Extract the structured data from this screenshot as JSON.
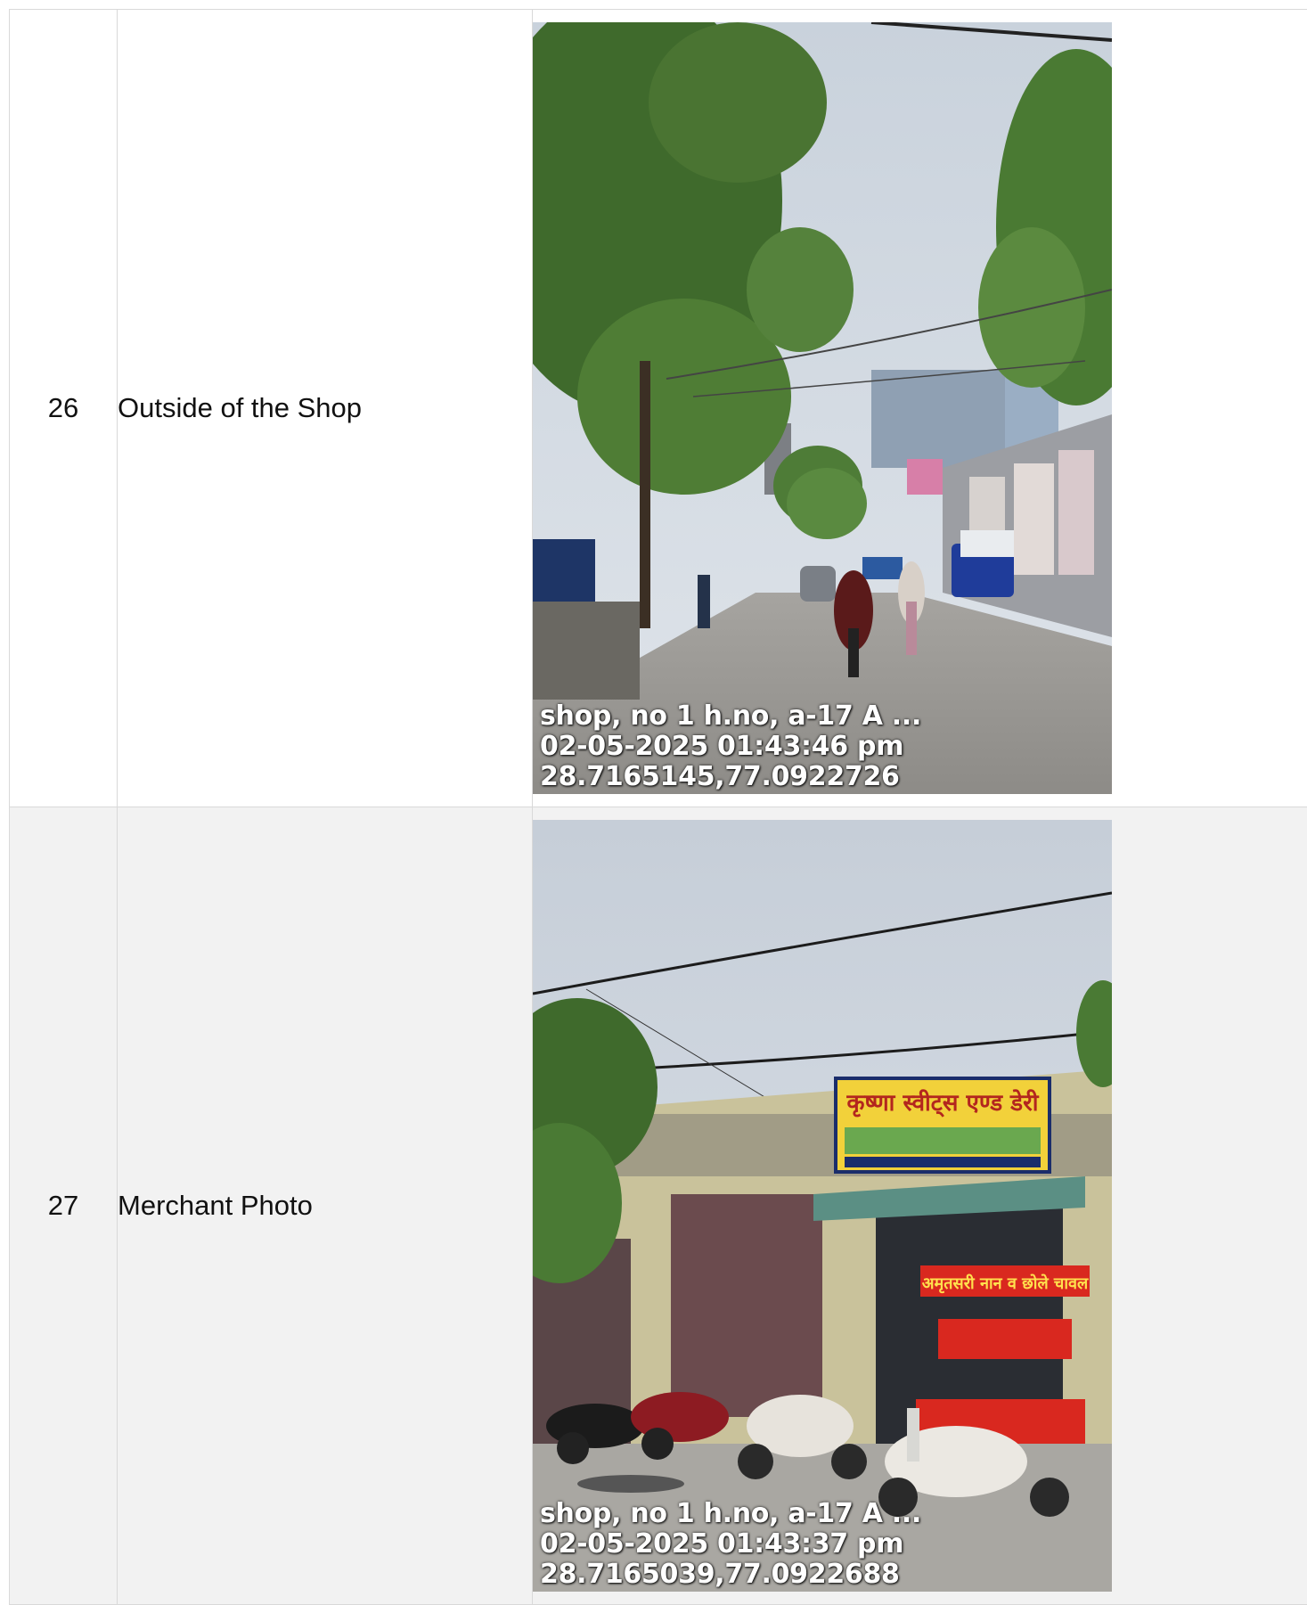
{
  "rows": [
    {
      "number": "26",
      "label": "Outside of the Shop",
      "photo": {
        "scene": "street-scene",
        "stamp": [
          "shop, no 1 h.no, a-17 A ...",
          "02-05-2025 01:43:46 pm",
          "28.7165145,77.0922726"
        ]
      }
    },
    {
      "number": "27",
      "label": "Merchant Photo",
      "photo": {
        "scene": "shopfront-scene",
        "signboard_text": "कृष्णा स्वीट्स एण्ड डेरी",
        "stall_text": "अमृतसरी नान व छोले चावल",
        "stamp": [
          "shop, no 1 h.no, a-17 A ...",
          "02-05-2025 01:43:37 pm",
          "28.7165039,77.0922688"
        ]
      }
    }
  ],
  "colors": {
    "row_alt_bg": "#f2f2f2",
    "border": "#d9d9d9",
    "stamp_text": "#ffffff"
  }
}
